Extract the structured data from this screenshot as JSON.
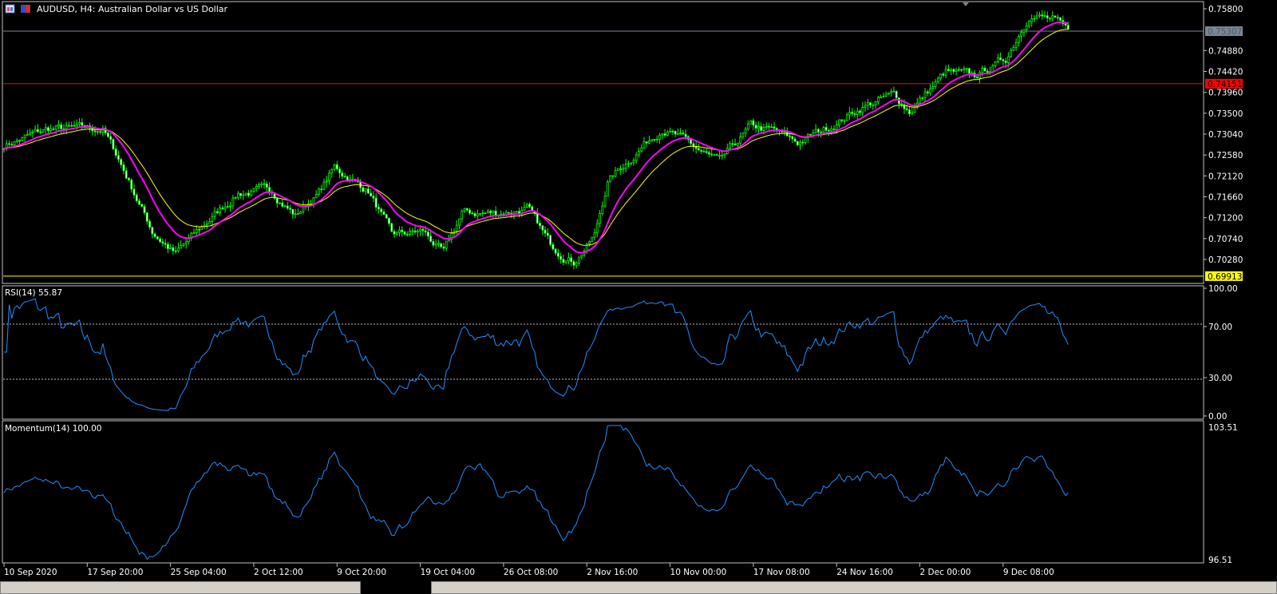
{
  "chart": {
    "title": "AUDUSD, H4:  Australian Dollar vs US Dollar",
    "price_ticks": [
      "0.75800",
      "0.74880",
      "0.74420",
      "0.73960",
      "0.73500",
      "0.73040",
      "0.72580",
      "0.72120",
      "0.71660",
      "0.71200",
      "0.70740",
      "0.70280"
    ],
    "bid_label": "0.75307",
    "red_line_label": "0.74151",
    "yellow_line_label": "0.69913",
    "colors": {
      "candle": "#00ff00",
      "ma_fast": "#ff00ff",
      "ma_slow": "#ffff00",
      "red_line": "#ff0000",
      "yellow_line": "#ffff00",
      "bid_line": "#778899",
      "indicator": "#1e90ff"
    }
  },
  "rsi": {
    "label": "RSI(14) 55.87",
    "ticks": [
      "100.00",
      "70.00",
      "30.00",
      "0.00"
    ]
  },
  "momentum": {
    "label": "Momentum(14) 100.00",
    "ticks": [
      "103.51",
      "96.51"
    ]
  },
  "time_axis": [
    "10 Sep 2020",
    "17 Sep 20:00",
    "25 Sep 04:00",
    "2 Oct 12:00",
    "9 Oct 20:00",
    "19 Oct 04:00",
    "26 Oct 08:00",
    "2 Nov 16:00",
    "10 Nov 00:00",
    "17 Nov 08:00",
    "24 Nov 16:00",
    "2 Dec 00:00",
    "9 Dec 08:00"
  ],
  "chart_data": {
    "type": "candlestick",
    "symbol": "AUDUSD",
    "timeframe": "H4",
    "bars": 410,
    "ylim": [
      0.6985,
      0.76
    ],
    "close_anchors": [
      [
        0,
        0.728
      ],
      [
        17,
        0.7315
      ],
      [
        38,
        0.7315
      ],
      [
        44,
        0.725
      ],
      [
        57,
        0.709
      ],
      [
        66,
        0.704
      ],
      [
        78,
        0.711
      ],
      [
        90,
        0.7175
      ],
      [
        103,
        0.718
      ],
      [
        112,
        0.7125
      ],
      [
        121,
        0.7175
      ],
      [
        127,
        0.723
      ],
      [
        140,
        0.718
      ],
      [
        149,
        0.708
      ],
      [
        161,
        0.709
      ],
      [
        169,
        0.704
      ],
      [
        176,
        0.713
      ],
      [
        189,
        0.713
      ],
      [
        201,
        0.714
      ],
      [
        210,
        0.706
      ],
      [
        219,
        0.7025
      ],
      [
        227,
        0.708
      ],
      [
        232,
        0.72
      ],
      [
        244,
        0.727
      ],
      [
        253,
        0.732
      ],
      [
        265,
        0.7275
      ],
      [
        275,
        0.724
      ],
      [
        287,
        0.732
      ],
      [
        296,
        0.731
      ],
      [
        305,
        0.7285
      ],
      [
        317,
        0.732
      ],
      [
        330,
        0.7365
      ],
      [
        342,
        0.739
      ],
      [
        348,
        0.7355
      ],
      [
        362,
        0.744
      ],
      [
        373,
        0.743
      ],
      [
        385,
        0.747
      ],
      [
        394,
        0.757
      ],
      [
        403,
        0.7555
      ],
      [
        408,
        0.7531
      ]
    ],
    "red_line": 0.74151,
    "yellow_line": 0.69913,
    "bid": 0.75307,
    "rsi": {
      "period": 14,
      "current": 55.87,
      "levels": [
        70,
        30
      ],
      "ylim": [
        0,
        100
      ]
    },
    "momentum": {
      "period": 14,
      "current": 100.0,
      "ylim": [
        96.51,
        103.51
      ]
    }
  }
}
